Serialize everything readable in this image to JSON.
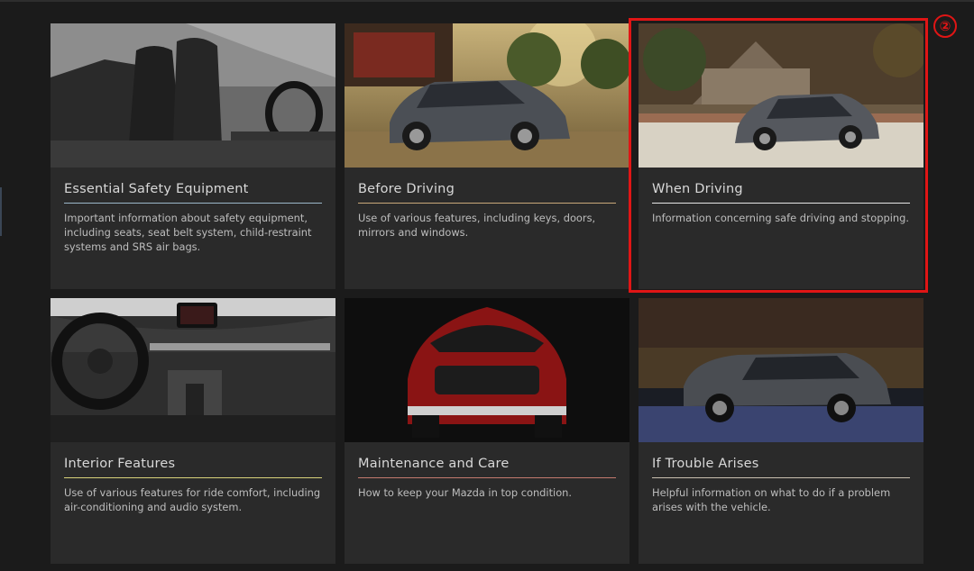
{
  "cards": [
    {
      "title": "Essential Safety Equipment",
      "description": "Important information about safety equipment, including seats, seat belt system, child-restraint systems and SRS air bags.",
      "image": "car-seats-interior",
      "rule_color": "#9bb7c9"
    },
    {
      "title": "Before Driving",
      "description": "Use of various features, including keys, doors, mirrors and windows.",
      "image": "suv-parked-outdoors",
      "rule_color": "#c9a87a"
    },
    {
      "title": "When Driving",
      "description": "Information concerning safe driving and stopping.",
      "image": "suv-driving-street",
      "rule_color": "#e6e6e6"
    },
    {
      "title": "Interior Features",
      "description": "Use of various features for ride comfort, including air-conditioning and audio system.",
      "image": "dashboard-steering-wheel",
      "rule_color": "#d9d27a"
    },
    {
      "title": "Maintenance and Care",
      "description": "How to keep your Mazda in top condition.",
      "image": "red-suv-front",
      "rule_color": "#c47a6e"
    },
    {
      "title": "If Trouble Arises",
      "description": "Helpful information on what to do if a problem arises with the vehicle.",
      "image": "suv-side-night",
      "rule_color": "#c9c0b0"
    }
  ],
  "annotation": {
    "marker": "②",
    "color": "#e01515",
    "highlighted_card": "When Driving"
  }
}
